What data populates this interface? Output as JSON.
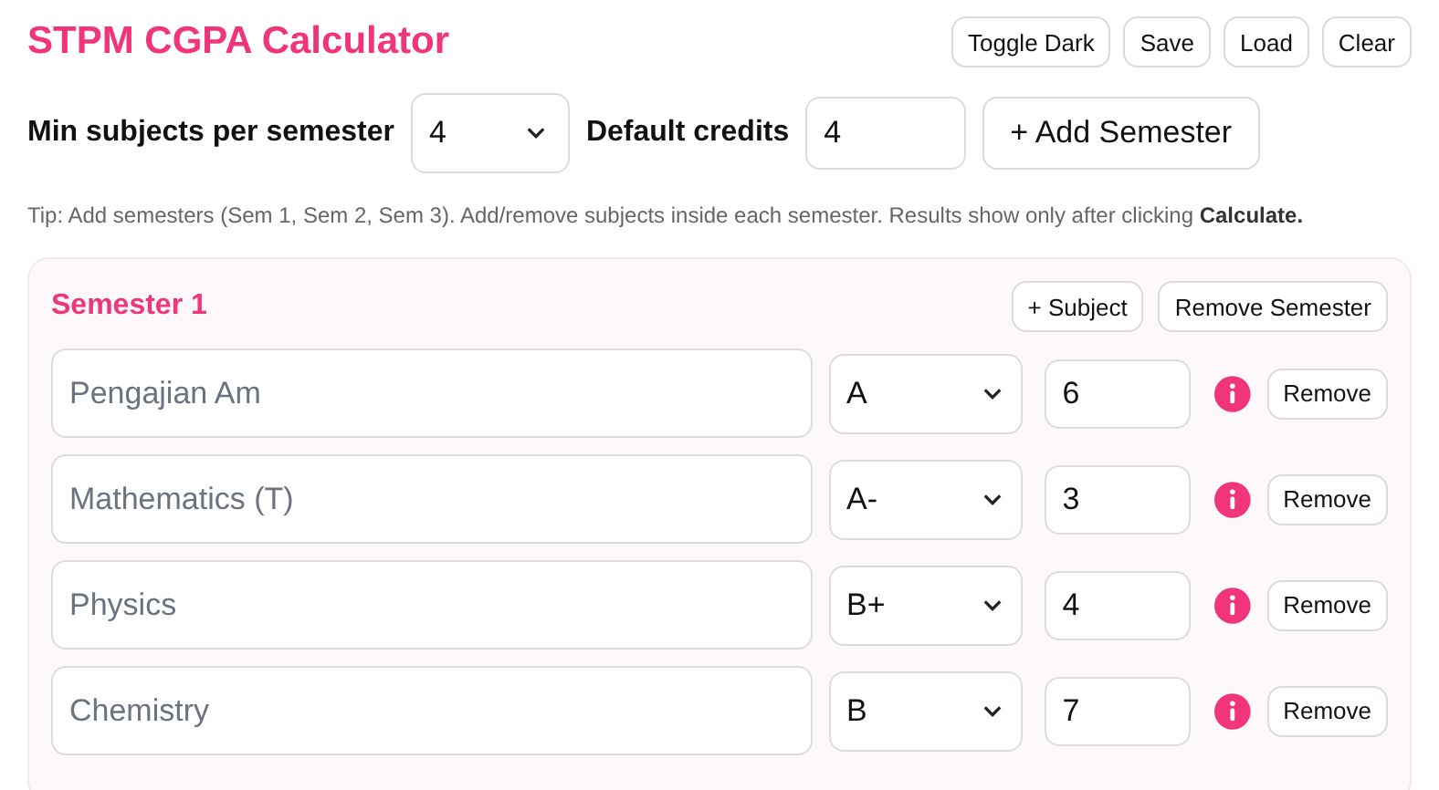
{
  "title": "STPM CGPA Calculator",
  "header_buttons": [
    "Toggle Dark",
    "Save",
    "Load",
    "Clear"
  ],
  "settings": {
    "min_subjects_label": "Min subjects per semester",
    "min_subjects_value": "4",
    "default_credits_label": "Default credits",
    "default_credits_value": "4",
    "add_semester": "+ Add Semester"
  },
  "tip": "Tip: Add semesters (Sem 1, Sem 2, Sem 3). Add/remove subjects inside each semester. Results show only after clicking **Calculate.**",
  "semesters": [
    {
      "title": "Semester 1",
      "add_subject": "+ Subject",
      "remove_semester": "Remove Semester",
      "subjects": [
        {
          "placeholder": "Pengajian Am",
          "grade": "A",
          "credits": "6",
          "remove": "Remove"
        },
        {
          "placeholder": "Mathematics (T)",
          "grade": "A-",
          "credits": "3",
          "remove": "Remove"
        },
        {
          "placeholder": "Physics",
          "grade": "B+",
          "credits": "4",
          "remove": "Remove"
        },
        {
          "placeholder": "Chemistry",
          "grade": "B",
          "credits": "7",
          "remove": "Remove"
        }
      ]
    }
  ]
}
